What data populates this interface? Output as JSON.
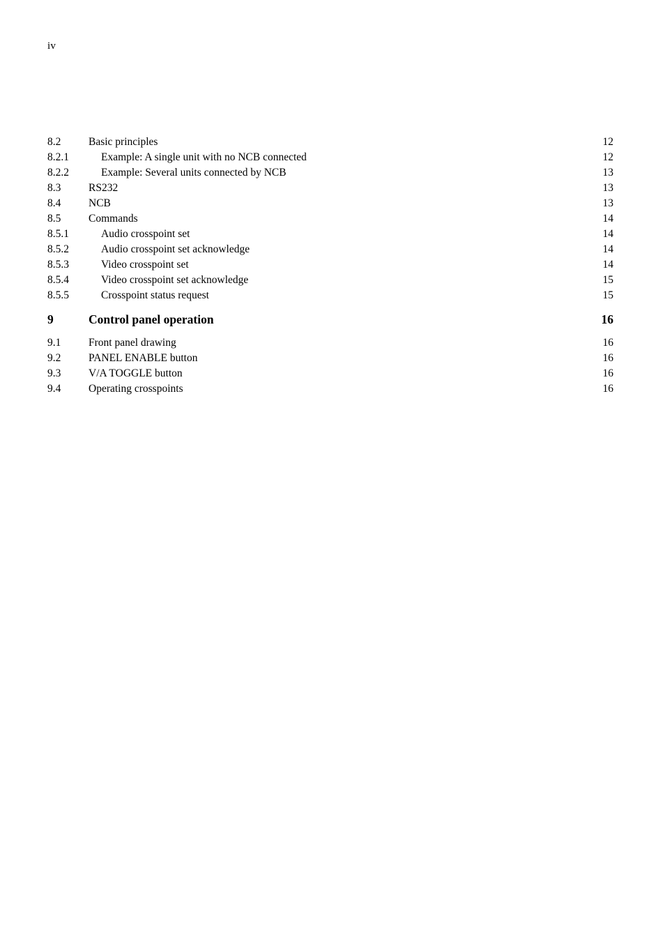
{
  "page": {
    "folio": "iv",
    "background_color": "#ffffff",
    "text_color": "#000000"
  },
  "toc": {
    "entries": [
      {
        "number": "8.2",
        "title": "Basic principles",
        "page": "12",
        "level": 2
      },
      {
        "number": "8.2.1",
        "title": "Example: A single unit with no NCB connected",
        "page": "12",
        "level": 3
      },
      {
        "number": "8.2.2",
        "title": "Example: Several units connected by NCB",
        "page": "13",
        "level": 3
      },
      {
        "number": "8.3",
        "title": "RS232",
        "page": "13",
        "level": 2
      },
      {
        "number": "8.4",
        "title": "NCB",
        "page": "13",
        "level": 2
      },
      {
        "number": "8.5",
        "title": "Commands",
        "page": "14",
        "level": 2
      },
      {
        "number": "8.5.1",
        "title": "Audio crosspoint set",
        "page": "14",
        "level": 3
      },
      {
        "number": "8.5.2",
        "title": "Audio crosspoint set acknowledge",
        "page": "14",
        "level": 3
      },
      {
        "number": "8.5.3",
        "title": "Video crosspoint set",
        "page": "14",
        "level": 3
      },
      {
        "number": "8.5.4",
        "title": "Video crosspoint set acknowledge",
        "page": "15",
        "level": 3
      },
      {
        "number": "8.5.5",
        "title": "Crosspoint status request",
        "page": "15",
        "level": 3
      },
      {
        "number": "9",
        "title": "Control panel operation",
        "page": "16",
        "level": 1
      },
      {
        "number": "9.1",
        "title": "Front panel drawing",
        "page": "16",
        "level": 2
      },
      {
        "number": "9.2",
        "title": "PANEL ENABLE button",
        "page": "16",
        "level": 2
      },
      {
        "number": "9.3",
        "title": "V/A TOGGLE button",
        "page": "16",
        "level": 2
      },
      {
        "number": "9.4",
        "title": "Operating crosspoints",
        "page": "16",
        "level": 2
      }
    ]
  }
}
